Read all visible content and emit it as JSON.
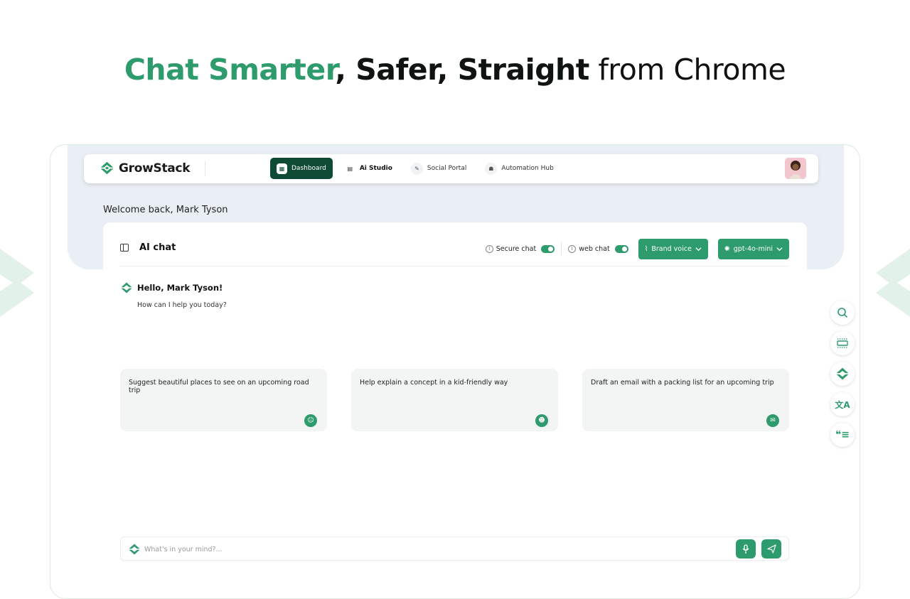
{
  "hero": {
    "part1": "Chat Smarter",
    "part2": ", Safer, Straight",
    "part3": " from Chrome"
  },
  "brand": {
    "name": "GrowStack",
    "accent": "#2e9b6d",
    "dark": "#0e4a34"
  },
  "nav": {
    "items": [
      {
        "label": "Dashboard",
        "icon": "dashboard-icon"
      },
      {
        "label": "Ai Studio",
        "icon": "chat-icon"
      },
      {
        "label": "Social Portal",
        "icon": "pen-icon"
      },
      {
        "label": "Automation Hub",
        "icon": "robot-icon"
      }
    ]
  },
  "welcome": "Welcome back, Mark Tyson",
  "chat": {
    "title": "AI chat",
    "secure_label": "Secure chat",
    "web_label": "web chat",
    "brand_voice_label": "Brand voice",
    "model_label": "gpt-4o-mini",
    "greeting": "Hello, Mark Tyson!",
    "subgreeting": "How can I help you today?",
    "suggestions": [
      {
        "text": "Suggest beautiful places to see on an upcoming road trip",
        "icon": "robot-icon"
      },
      {
        "text": "Help explain a concept in a kid-friendly way",
        "icon": "smile-icon"
      },
      {
        "text": "Draft an email with a packing list for an upcoming trip",
        "icon": "mail-icon"
      }
    ],
    "input_placeholder": "What's in your mind?..."
  },
  "side_tools": [
    "search-icon",
    "screenshot-icon",
    "growstack-logo-icon",
    "translate-icon",
    "quote-icon"
  ]
}
